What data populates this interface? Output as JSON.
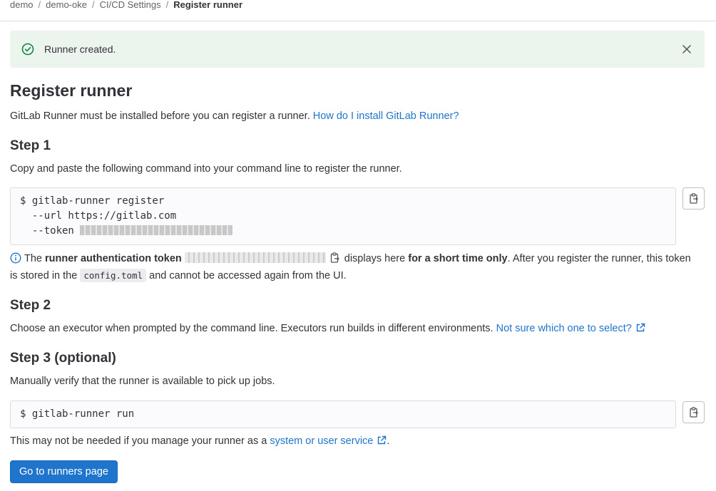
{
  "breadcrumb": {
    "items": [
      "demo",
      "demo-oke",
      "CI/CD Settings"
    ],
    "current": "Register runner",
    "separator": "/"
  },
  "alert": {
    "message": "Runner created.",
    "icon": "check-circle-icon",
    "close_icon": "close-icon",
    "bg_color": "#ecf4ee"
  },
  "page": {
    "title": "Register runner",
    "intro": "GitLab Runner must be installed before you can register a runner.",
    "install_link": "How do I install GitLab Runner?"
  },
  "step1": {
    "heading": "Step 1",
    "description": "Copy and paste the following command into your command line to register the runner.",
    "command_lines": [
      "$ gitlab-runner register",
      "  --url https://gitlab.com",
      "  --token "
    ],
    "info_prefix": "The ",
    "info_bold1": "runner authentication token",
    "info_mid": "displays here ",
    "info_bold2": "for a short time only",
    "info_suffix": ". After you register the runner, this token",
    "info_line2_prefix": "is stored in the ",
    "info_code": "config.toml",
    "info_line2_suffix": " and cannot be accessed again from the UI."
  },
  "step2": {
    "heading": "Step 2",
    "description": "Choose an executor when prompted by the command line. Executors run builds in different environments.",
    "link": "Not sure which one to select?"
  },
  "step3": {
    "heading": "Step 3 (optional)",
    "description": "Manually verify that the runner is available to pick up jobs.",
    "command": "$ gitlab-runner run",
    "note_prefix": "This may not be needed if you manage your runner as a ",
    "note_link": "system or user service",
    "note_suffix": "."
  },
  "button": {
    "label": "Go to runners page",
    "color": "#1f75cb"
  },
  "colors": {
    "link": "#1f75cb",
    "success": "#108548",
    "text": "#333238"
  }
}
